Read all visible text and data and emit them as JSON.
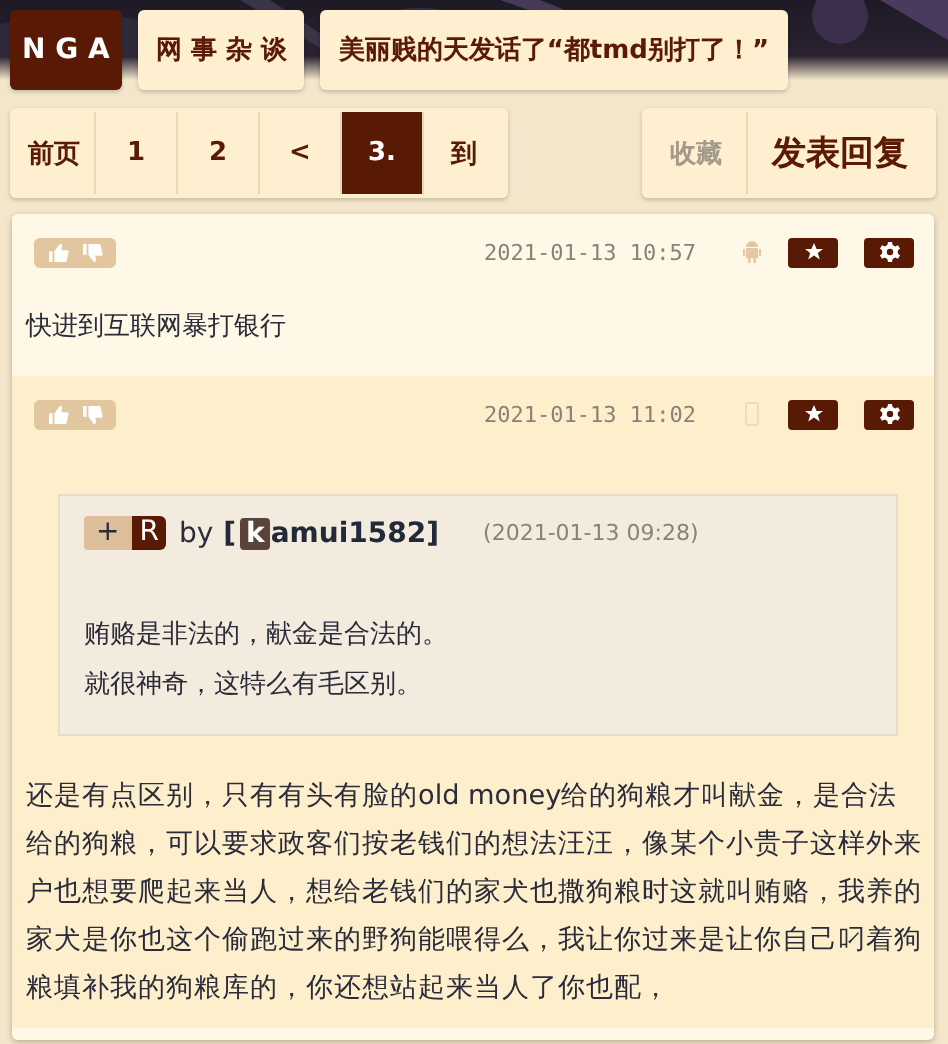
{
  "breadcrumbs": [
    {
      "label": "N G A",
      "kind": "logo"
    },
    {
      "label": "网 事 杂 谈",
      "kind": "forum"
    },
    {
      "label": "美丽贱的天发话了“都tmd别打了！”",
      "kind": "topic"
    }
  ],
  "pagination": [
    {
      "label": "前页",
      "selected": false
    },
    {
      "label": "1",
      "selected": false
    },
    {
      "label": "2",
      "selected": false
    },
    {
      "label": "<",
      "selected": false
    },
    {
      "label": "3.",
      "selected": true
    },
    {
      "label": "到",
      "selected": false
    }
  ],
  "actions": [
    {
      "label": "收藏",
      "disabled": true
    },
    {
      "label": "发表回复",
      "disabled": false
    }
  ],
  "posts": [
    {
      "time": "2021-01-13 10:57",
      "kind": "android",
      "highlight": false,
      "paragraphs": [
        "快进到互联网暴打银行"
      ]
    },
    {
      "time": "2021-01-13 11:02",
      "kind": "phone",
      "highlight": true,
      "quote": {
        "tags": [
          "+",
          "R"
        ],
        "by": "by",
        "open": "[",
        "initial": "k",
        "author": "amui1582",
        "close": "]",
        "time": "(2021-01-13 09:28)",
        "lines": [
          "贿赂是非法的，献金是合法的。",
          "就很神奇，这特么有毛区别。"
        ]
      },
      "paragraphs": [
        "还是有点区别，只有有头有脸的old money给的狗粮才叫献金，是合法给的狗粮，可以要求政客们按老钱们的想法汪汪，像某个小贵子这样外来户也想要爬起来当人，想给老钱们的家犬也撒狗粮时这就叫贿赂，我养的家犬是你也这个偷跑过来的野狗能喂得么，我让你过来是让你自己叼着狗粮填补我的狗粮库的，你还想站起来当人了你也配，"
      ]
    }
  ]
}
